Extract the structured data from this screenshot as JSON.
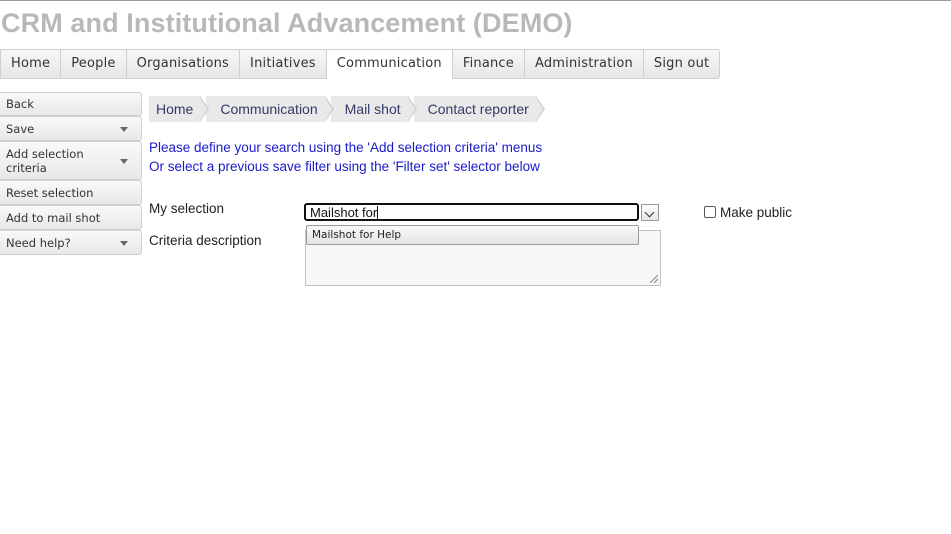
{
  "app": {
    "title": "CRM and Institutional Advancement (DEMO)"
  },
  "nav": {
    "tabs": [
      {
        "label": "Home"
      },
      {
        "label": "People"
      },
      {
        "label": "Organisations"
      },
      {
        "label": "Initiatives"
      },
      {
        "label": "Communication",
        "active": true
      },
      {
        "label": "Finance"
      },
      {
        "label": "Administration"
      },
      {
        "label": "Sign out"
      }
    ]
  },
  "sidebar": {
    "items": [
      {
        "label": "Back"
      },
      {
        "label": "Save",
        "has_menu": true
      },
      {
        "label": "Add selection criteria",
        "has_menu": true
      },
      {
        "label": "Reset selection"
      },
      {
        "label": "Add to mail shot"
      },
      {
        "label": "Need help?",
        "has_menu": true
      }
    ]
  },
  "breadcrumb": [
    "Home",
    "Communication",
    "Mail shot",
    "Contact reporter"
  ],
  "instructions": {
    "line1": "Please define your search using the 'Add selection criteria' menus",
    "line2": "Or select a previous save filter using the 'Filter set' selector below"
  },
  "form": {
    "my_selection_label": "My selection",
    "my_selection_value": "Mailshot for",
    "suggestion": "Mailshot for Help",
    "criteria_label": "Criteria description",
    "criteria_value": "",
    "make_public_label": "Make public",
    "make_public_checked": false
  },
  "colors": {
    "title": "#b8b8b8",
    "instruction_text": "#1a1ac9",
    "breadcrumb_text": "#333b66"
  }
}
